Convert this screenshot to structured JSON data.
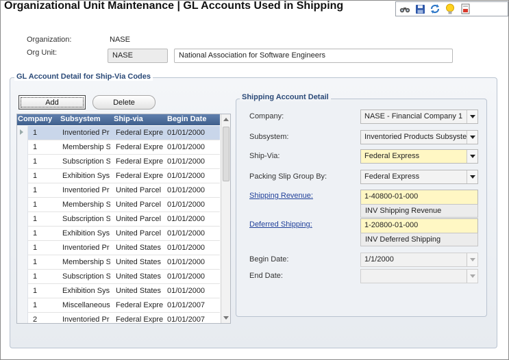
{
  "title": "Organizational Unit Maintenance | GL Accounts Used in Shipping",
  "toolbar": {
    "icons": [
      "binoculars-icon",
      "save-icon",
      "refresh-icon",
      "lightbulb-icon",
      "report-icon"
    ]
  },
  "header": {
    "organization_label": "Organization:",
    "organization_value": "NASE",
    "org_unit_label": "Org Unit:",
    "org_unit_code": "NASE",
    "org_unit_name": "National Association for Software Engineers"
  },
  "gl_group": {
    "title": "GL Account Detail for Ship-Via Codes",
    "add_label": "Add",
    "delete_label": "Delete",
    "columns": [
      "Company",
      "Subsystem",
      "Ship-via",
      "Begin Date"
    ],
    "rows": [
      {
        "company": "1",
        "subsystem": "Inventoried Pr",
        "ship_via": "Federal Expre",
        "begin_date": "01/01/2000"
      },
      {
        "company": "1",
        "subsystem": "Membership S",
        "ship_via": "Federal Expre",
        "begin_date": "01/01/2000"
      },
      {
        "company": "1",
        "subsystem": "Subscription S",
        "ship_via": "Federal Expre",
        "begin_date": "01/01/2000"
      },
      {
        "company": "1",
        "subsystem": "Exhibition Sys",
        "ship_via": "Federal Expre",
        "begin_date": "01/01/2000"
      },
      {
        "company": "1",
        "subsystem": "Inventoried Pr",
        "ship_via": "United Parcel",
        "begin_date": "01/01/2000"
      },
      {
        "company": "1",
        "subsystem": "Membership S",
        "ship_via": "United Parcel",
        "begin_date": "01/01/2000"
      },
      {
        "company": "1",
        "subsystem": "Subscription S",
        "ship_via": "United Parcel",
        "begin_date": "01/01/2000"
      },
      {
        "company": "1",
        "subsystem": "Exhibition Sys",
        "ship_via": "United Parcel",
        "begin_date": "01/01/2000"
      },
      {
        "company": "1",
        "subsystem": "Inventoried Pr",
        "ship_via": "United States",
        "begin_date": "01/01/2000"
      },
      {
        "company": "1",
        "subsystem": "Membership S",
        "ship_via": "United States",
        "begin_date": "01/01/2000"
      },
      {
        "company": "1",
        "subsystem": "Subscription S",
        "ship_via": "United States",
        "begin_date": "01/01/2000"
      },
      {
        "company": "1",
        "subsystem": "Exhibition Sys",
        "ship_via": "United States",
        "begin_date": "01/01/2000"
      },
      {
        "company": "1",
        "subsystem": "Miscellaneous",
        "ship_via": "Federal Expre",
        "begin_date": "01/01/2007"
      },
      {
        "company": "2",
        "subsystem": "Inventoried Pr",
        "ship_via": "Federal Expre",
        "begin_date": "01/01/2007"
      }
    ]
  },
  "detail": {
    "title": "Shipping Account Detail",
    "company_label": "Company:",
    "company_value": "NASE - Financial Company 1",
    "subsystem_label": "Subsystem:",
    "subsystem_value": "Inventoried Products Subsystem",
    "ship_via_label": "Ship-Via:",
    "ship_via_value": "Federal Express",
    "packing_label": "Packing Slip Group By:",
    "packing_value": "Federal Express",
    "revenue_label": "Shipping Revenue:",
    "revenue_account": "1-40800-01-000",
    "revenue_desc": "INV Shipping Revenue",
    "deferred_label": "Deferred Shipping:",
    "deferred_account": "1-20800-01-000",
    "deferred_desc": "INV Deferred Shipping",
    "begin_label": "Begin Date:",
    "begin_value": "1/1/2000",
    "end_label": "End Date:",
    "end_value": ""
  }
}
